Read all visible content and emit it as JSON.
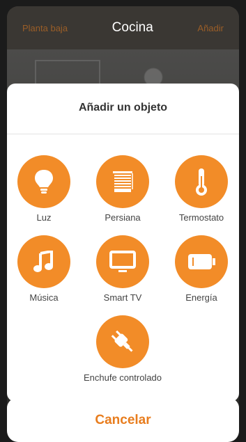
{
  "header": {
    "left_label": "Planta baja",
    "title": "Cocina",
    "right_label": "Añadir"
  },
  "sheet": {
    "title": "Añadir un objeto",
    "items": [
      {
        "label": "Luz",
        "icon": "lightbulb-icon"
      },
      {
        "label": "Persiana",
        "icon": "blind-icon"
      },
      {
        "label": "Termostato",
        "icon": "thermometer-icon"
      },
      {
        "label": "Música",
        "icon": "music-note-icon"
      },
      {
        "label": "Smart TV",
        "icon": "tv-icon"
      },
      {
        "label": "Energía",
        "icon": "battery-icon"
      },
      {
        "label": "Enchufe controlado",
        "icon": "plug-icon"
      }
    ]
  },
  "cancel_label": "Cancelar",
  "colors": {
    "accent": "#f28c28",
    "accent_text": "#e87d1e"
  }
}
